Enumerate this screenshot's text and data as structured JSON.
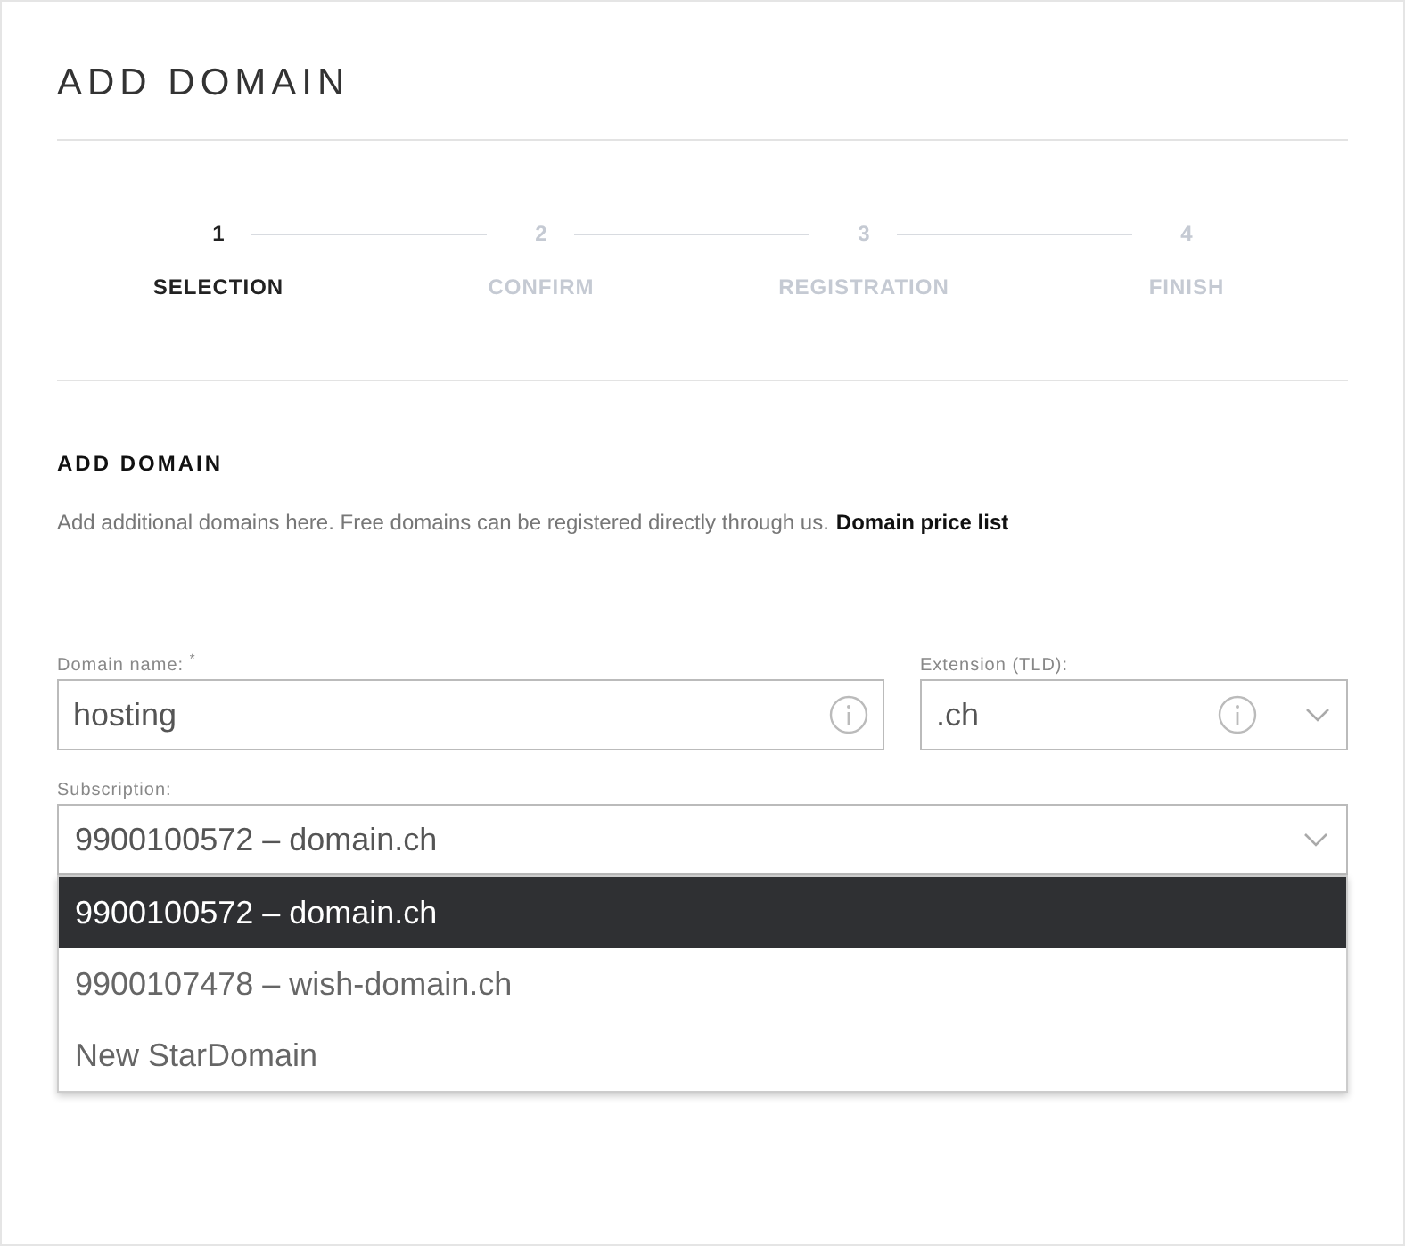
{
  "page_title": "ADD DOMAIN",
  "steps": [
    {
      "number": "1",
      "label": "SELECTION",
      "active": true
    },
    {
      "number": "2",
      "label": "CONFIRM",
      "active": false
    },
    {
      "number": "3",
      "label": "REGISTRATION",
      "active": false
    },
    {
      "number": "4",
      "label": "FINISH",
      "active": false
    }
  ],
  "section": {
    "heading": "ADD DOMAIN",
    "description": "Add additional domains here. Free domains can be registered directly through us.",
    "link": "Domain price list"
  },
  "domain_field": {
    "label": "Domain name: $^{*}$",
    "value": "hosting"
  },
  "extension_field": {
    "label": "Extension (TLD):",
    "value": ".ch"
  },
  "subscription": {
    "label": "Subscription:",
    "value": "9900100572 – domain.ch",
    "expanded": true,
    "options": [
      {
        "label": "9900100572 – domain.ch",
        "selected": true
      },
      {
        "label": "9900107478 – wish-domain.ch",
        "selected": false
      },
      {
        "label": "New StarDomain",
        "selected": false
      }
    ]
  }
}
